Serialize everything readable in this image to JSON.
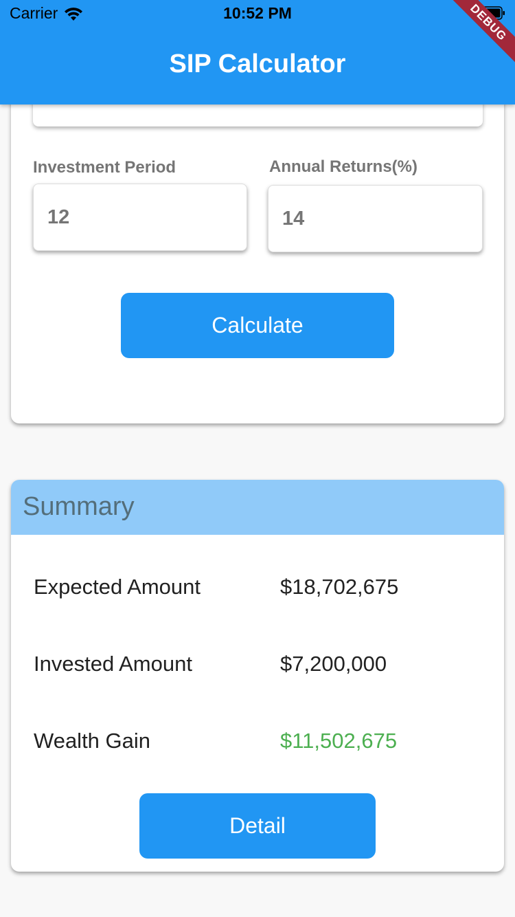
{
  "status_bar": {
    "carrier": "Carrier",
    "time": "10:52 PM"
  },
  "app_bar": {
    "title": "SIP Calculator",
    "debug_banner": "DEBUG"
  },
  "form": {
    "investment_period": {
      "label": "Investment Period",
      "value": "12"
    },
    "annual_returns": {
      "label": "Annual Returns(%)",
      "value": "14"
    },
    "calculate_label": "Calculate"
  },
  "summary": {
    "title": "Summary",
    "rows": [
      {
        "label": "Expected Amount",
        "value": "$18,702,675"
      },
      {
        "label": "Invested Amount",
        "value": "$7,200,000"
      },
      {
        "label": "Wealth Gain",
        "value": "$11,502,675"
      }
    ],
    "detail_label": "Detail"
  },
  "colors": {
    "primary": "#2196f3",
    "summary_header": "#90caf9",
    "gain": "#4caf50",
    "debug": "#a2283a"
  }
}
